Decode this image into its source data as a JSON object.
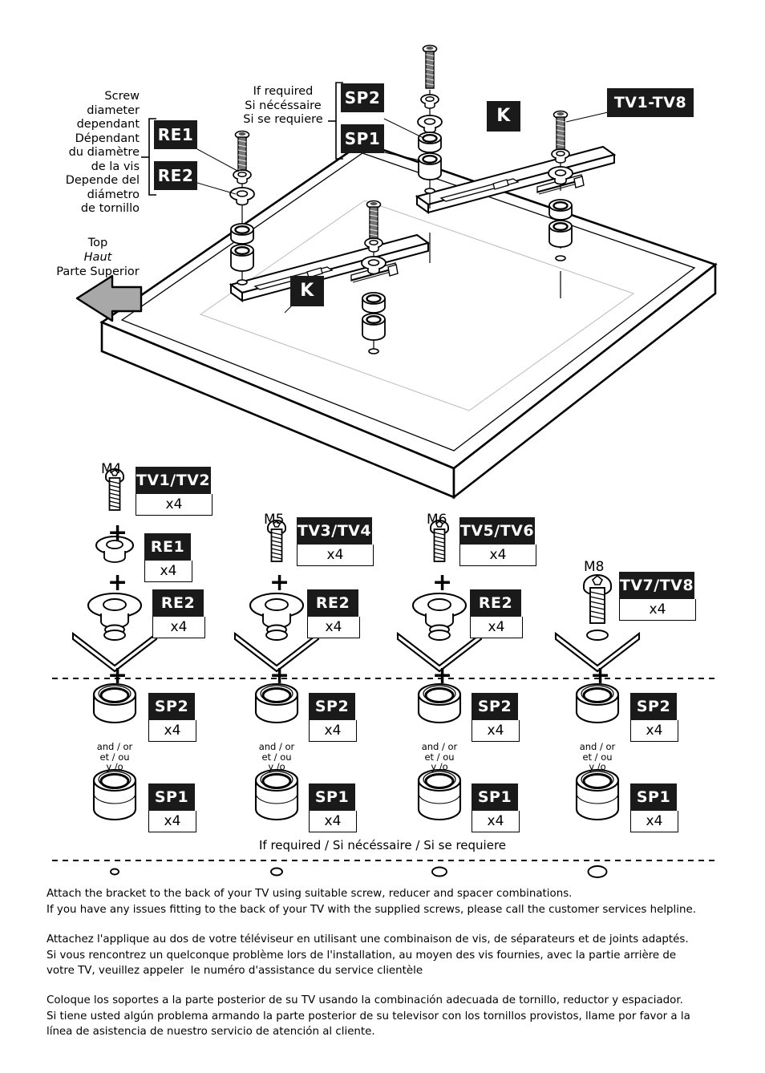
{
  "diagram": {
    "callouts": {
      "screw_diameter": "Screw\ndiameter\ndependant\nDépendant\ndu diamètre\nde la vis\nDepende del\ndiámetro\nde tornillo",
      "if_required": "If required\nSi nécéssaire\nSi se requiere",
      "top_en": "Top",
      "top_fr": "Haut",
      "top_es": "Parte Superior"
    },
    "labels": {
      "re1": "RE1",
      "re2": "RE2",
      "sp2": "SP2",
      "sp1": "SP1",
      "k_left": "K",
      "k_right": "K",
      "tv_range": "TV1-TV8"
    }
  },
  "parts_table": {
    "columns": [
      {
        "screw_size": "M4",
        "screw_label": "TV1/TV2",
        "screw_qty": "x4",
        "reducers": [
          {
            "label": "RE1",
            "qty": "x4"
          },
          {
            "label": "RE2",
            "qty": "x4"
          }
        ],
        "spacers": [
          {
            "label": "SP2",
            "qty": "x4"
          },
          {
            "label": "SP1",
            "qty": "x4"
          }
        ],
        "and_or": "and / or\net / ou\ny /o"
      },
      {
        "screw_size": "M5",
        "screw_label": "TV3/TV4",
        "screw_qty": "x4",
        "reducers": [
          {
            "label": "RE2",
            "qty": "x4"
          }
        ],
        "spacers": [
          {
            "label": "SP2",
            "qty": "x4"
          },
          {
            "label": "SP1",
            "qty": "x4"
          }
        ],
        "and_or": "and / or\net / ou\ny /o"
      },
      {
        "screw_size": "M6",
        "screw_label": "TV5/TV6",
        "screw_qty": "x4",
        "reducers": [
          {
            "label": "RE2",
            "qty": "x4"
          }
        ],
        "spacers": [
          {
            "label": "SP2",
            "qty": "x4"
          },
          {
            "label": "SP1",
            "qty": "x4"
          }
        ],
        "and_or": "and / or\net / ou\ny /o"
      },
      {
        "screw_size": "M8",
        "screw_label": "TV7/TV8",
        "screw_qty": "x4",
        "reducers": [],
        "spacers": [
          {
            "label": "SP2",
            "qty": "x4"
          },
          {
            "label": "SP1",
            "qty": "x4"
          }
        ],
        "and_or": "and / or\net / ou\ny /o"
      }
    ],
    "if_required_note": "If required / Si nécéssaire / Si se requiere",
    "plus_symbol": "+"
  },
  "instructions": {
    "english": "Attach the bracket to the back of your TV using suitable screw, reducer and spacer combinations.\nIf you have any issues fitting to the back of your TV with the supplied screws, please call the customer services helpline.",
    "french": "Attachez l'applique au dos de votre téléviseur en utilisant une combinaison de vis, de séparateurs et de joints adaptés.\nSi vous rencontrez un quelconque problème lors de l'installation, au moyen des vis fournies, avec la partie arrière de\nvotre TV, veuillez appeler  le numéro d'assistance du service clientèle",
    "spanish": "Coloque los soportes a la parte posterior de su TV usando la combinación adecuada de tornillo, reductor y espaciador.\nSi tiene usted algún problema armando la parte posterior de su televisor con los tornillos provistos, llame por favor a la\nlínea de asistencia de nuestro servicio de atención al cliente."
  },
  "colors": {
    "chip_bg": "#1a1a1a",
    "arrow_fill": "#a8a8a8",
    "line": "#000000"
  }
}
